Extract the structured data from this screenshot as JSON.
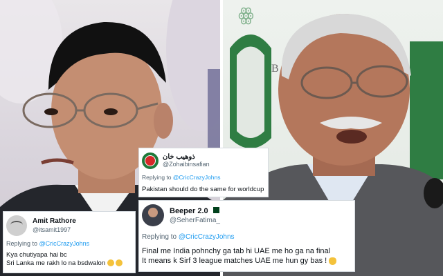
{
  "tweets": [
    {
      "name": "ذوهيب خان",
      "handle": "@Zohaibinsafian",
      "replying_prefix": "Replying to ",
      "mention": "@CricCrazyJohns",
      "text": "Pakistan should do the same for worldcup"
    },
    {
      "name": "Beeper 2.0",
      "handle": "@SeherFatima_",
      "replying_prefix": "Replying to ",
      "mention": "@CricCrazyJohns",
      "line1": "Final me India pohnchy ga tab hi UAE me ho ga na final",
      "line2": "It means k Sirf 3 league matches UAE me hun gy bas !"
    },
    {
      "name": "Amit Rathore",
      "handle": "@itsamit1997",
      "replying_prefix": "Replying to ",
      "mention": "@CricCrazyJohns",
      "line1": "Kya chutiyapa hai bc",
      "line2": "Sri Lanka me rakh lo na bsdwalon"
    }
  ],
  "icons": {
    "flag": "pakistan-flag-icon",
    "emoji_face": "face-emoji-icon",
    "emoji_hand": "hand-emoji-icon"
  },
  "colors": {
    "mention": "#1d9bf0",
    "handle": "#536471",
    "pti_red": "#d62828",
    "pti_green": "#1f7a3a"
  }
}
